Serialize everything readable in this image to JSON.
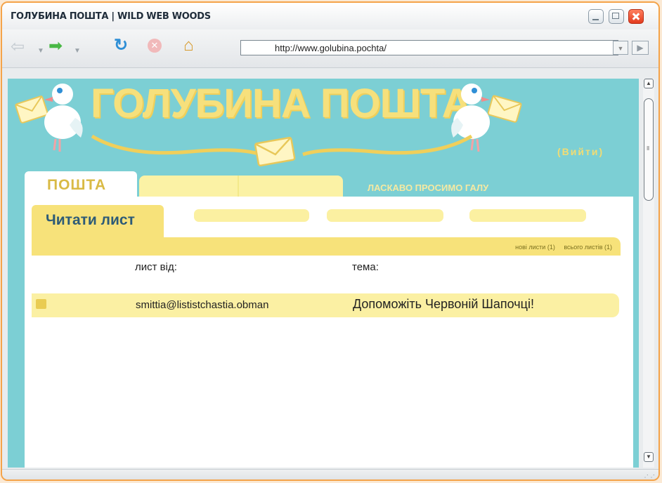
{
  "window": {
    "title": "ГОЛУБИНА ПОШТА | WILD WEB WOODS"
  },
  "toolbar": {
    "url": "http://www.golubina.pochta/"
  },
  "site": {
    "logo": "ГОЛУБИНА ПОШТА",
    "logout": "(Вийти)",
    "main_tab": "ПОШТА",
    "welcome": "ЛАСКАВО ПРОСИМО ГАЛУ",
    "sub_tab": "Читати лист",
    "new_count": "нові листи (1)",
    "total_count": "всього листів (1)",
    "col_from": "лист від:",
    "col_subject": "тема:"
  },
  "messages": [
    {
      "from": "smittia@lististchastia.obman",
      "subject": "Допоможіть Червоній Шапочці!"
    }
  ],
  "colors": {
    "accent": "#f7e27a",
    "background": "#7ccfd4",
    "frame": "#f4a349"
  }
}
